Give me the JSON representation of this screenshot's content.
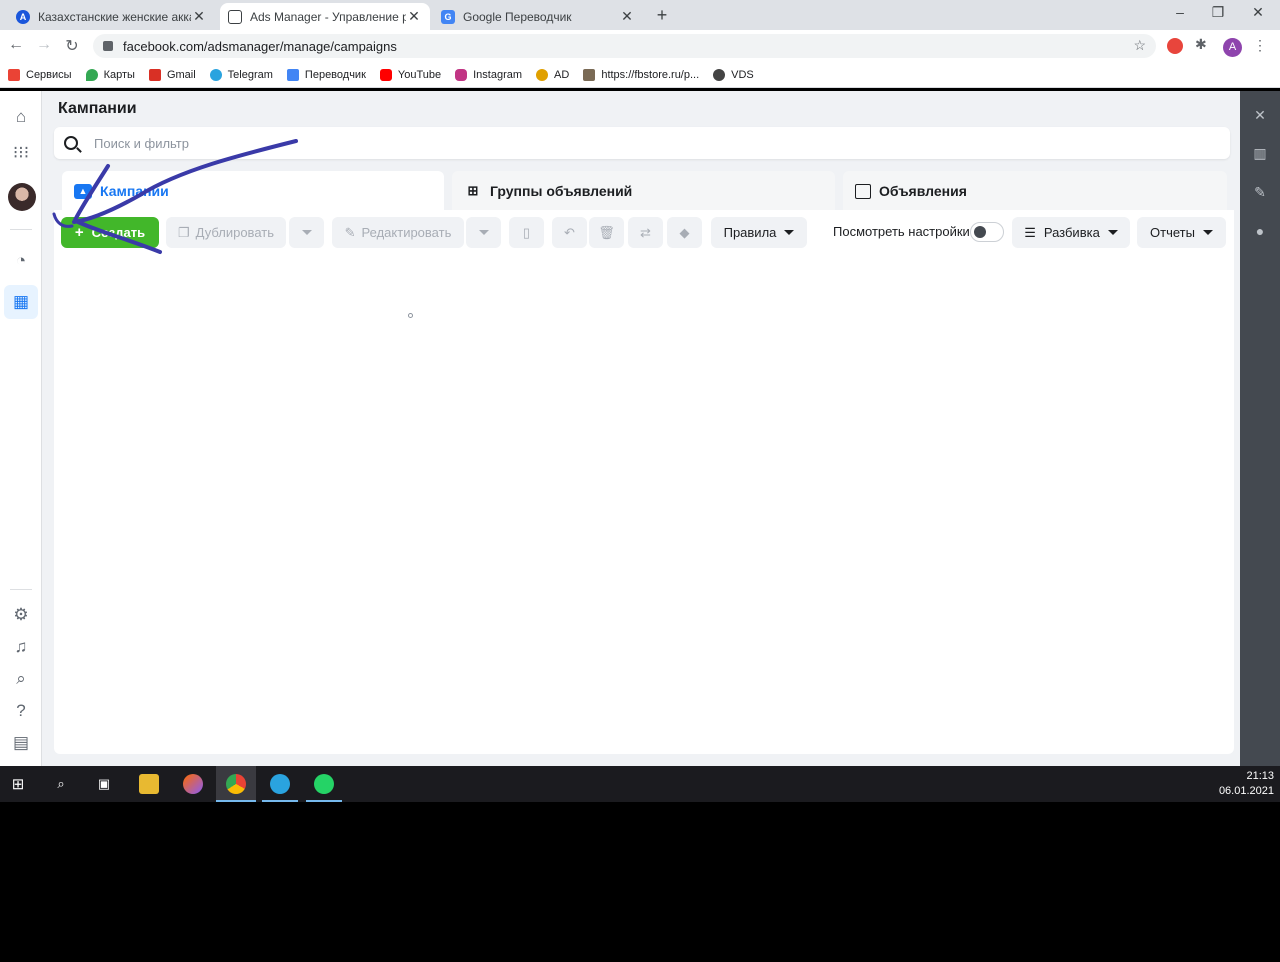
{
  "browser": {
    "tabs": [
      {
        "title": "Казахстанские женские аккаунт",
        "favicon_color": "#1a56db",
        "favicon_glyph": "A"
      },
      {
        "title": "Ads Manager - Управление рек",
        "favicon_color": "#3c4043",
        "favicon_glyph": "▣"
      },
      {
        "title": "Google Переводчик",
        "favicon_color": "#4285f4",
        "favicon_glyph": "G"
      }
    ],
    "close_glyph": "✕",
    "new_tab_glyph": "+",
    "url": "facebook.com/adsmanager/manage/campaigns",
    "profile_initial": "A",
    "bookmarks": [
      {
        "label": "Сервисы",
        "color": "#ea4335"
      },
      {
        "label": "Карты",
        "color": "#34a853"
      },
      {
        "label": "Gmail",
        "color": "#d93025"
      },
      {
        "label": "Telegram",
        "color": "#2aa3df"
      },
      {
        "label": "Переводчик",
        "color": "#4285f4"
      },
      {
        "label": "YouTube",
        "color": "#ff0000"
      },
      {
        "label": "Instagram",
        "color": "#c13584"
      },
      {
        "label": "AD",
        "color": "#e0a000"
      },
      {
        "label": "https://fbstore.ru/p...",
        "color": "#7a6a55"
      },
      {
        "label": "VDS",
        "color": "#444444"
      }
    ]
  },
  "app": {
    "page_title": "Кампании",
    "search_placeholder": "Поиск и фильтр",
    "tabs": [
      {
        "label": "Кампании",
        "icon": "campaign-folder-icon"
      },
      {
        "label": "Группы объявлений",
        "icon": "grid-icon"
      },
      {
        "label": "Объявления",
        "icon": "ad-window-icon"
      }
    ],
    "toolbar": {
      "create": "Создать",
      "duplicate": "Дублировать",
      "edit": "Редактировать",
      "rules": "Правила",
      "view_settings": "Посмотреть настройки",
      "breakdown": "Разбивка",
      "reports": "Отчеты"
    },
    "accent": "#1877f2",
    "create_color": "#42b72a"
  },
  "taskbar": {
    "time": "21:13",
    "date": "06.01.2021"
  }
}
